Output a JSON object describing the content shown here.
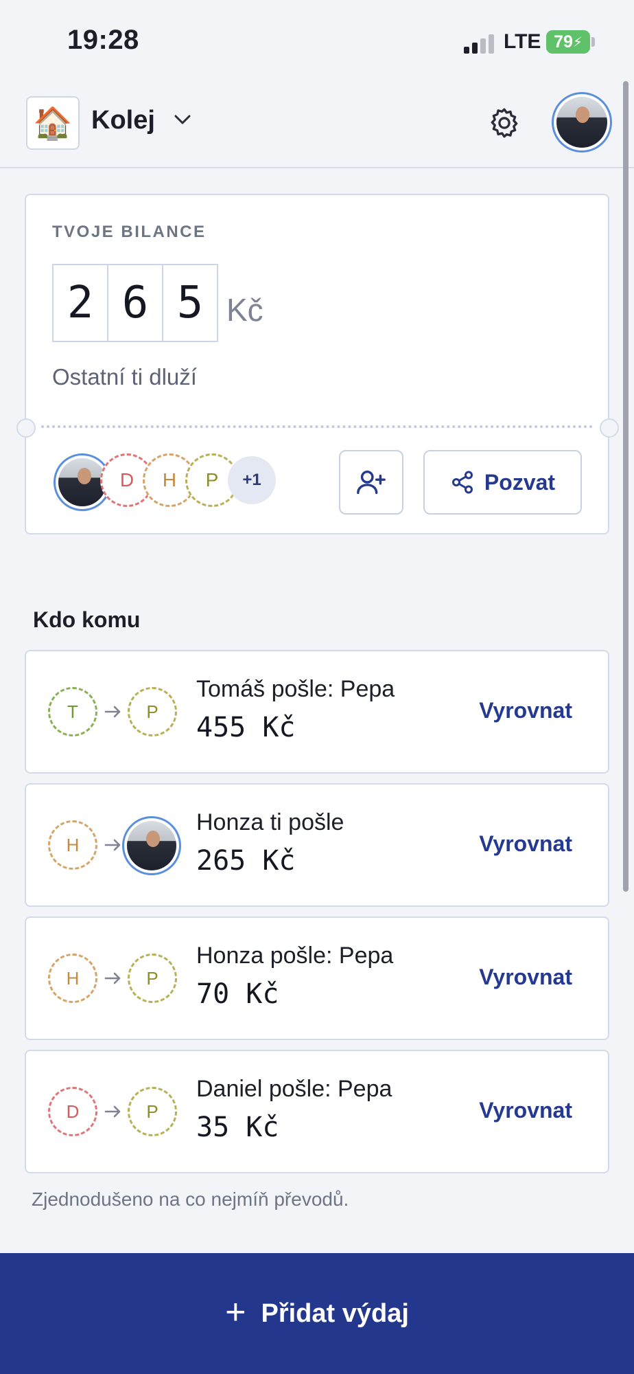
{
  "status_bar": {
    "time": "19:28",
    "network": "LTE",
    "battery": "79"
  },
  "header": {
    "group_emoji": "🏠",
    "group_name": "Kolej",
    "icons": [
      "chevron-down-icon",
      "gear-icon",
      "avatar"
    ]
  },
  "balance": {
    "label": "TVOJE BILANCE",
    "digits": [
      "2",
      "6",
      "5"
    ],
    "currency": "Kč",
    "caption": "Ostatní ti dluží"
  },
  "members": {
    "initials": [
      "D",
      "H",
      "P"
    ],
    "more": "+1",
    "invite_label": "Pozvat"
  },
  "settlements": {
    "title": "Kdo komu",
    "action_label": "Vyrovnat",
    "rows": [
      {
        "from": "T",
        "to": "P",
        "to_is_photo": false,
        "text": "Tomáš pošle: Pepa",
        "amount": "455 Kč"
      },
      {
        "from": "H",
        "to": "",
        "to_is_photo": true,
        "text": "Honza ti pošle",
        "amount": "265 Kč"
      },
      {
        "from": "H",
        "to": "P",
        "to_is_photo": false,
        "text": "Honza pošle: Pepa",
        "amount": "70 Kč"
      },
      {
        "from": "D",
        "to": "P",
        "to_is_photo": false,
        "text": "Daniel pošle: Pepa",
        "amount": "35 Kč"
      }
    ],
    "footnote": "Zjednodušeno na co nejmíň převodů."
  },
  "primary_action": {
    "plus": "+",
    "label": "Přidat výdaj"
  },
  "colors": {
    "accent": "#23388d",
    "avatar_ring": "#5b8fdc",
    "battery": "#5fc26a"
  }
}
